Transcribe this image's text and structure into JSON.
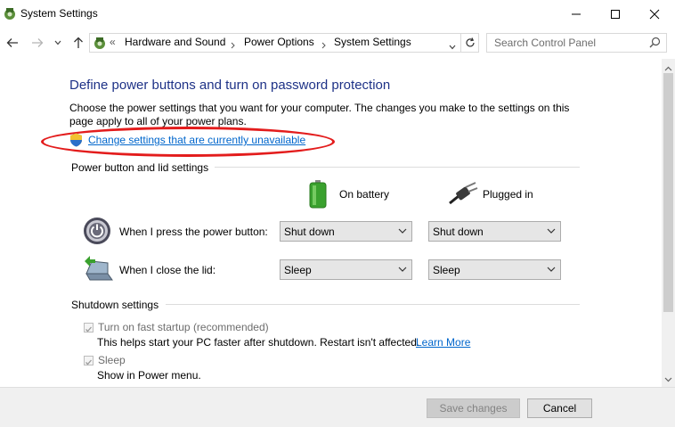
{
  "window": {
    "title": "System Settings",
    "minimize": "—",
    "maximize": "☐",
    "close": "✕"
  },
  "address": {
    "overflow": "«",
    "breadcrumbs": [
      "Hardware and Sound",
      "Power Options",
      "System Settings"
    ],
    "search_placeholder": "Search Control Panel"
  },
  "main": {
    "heading": "Define power buttons and turn on password protection",
    "description": "Choose the power settings that you want for your computer. The changes you make to the settings on this page apply to all of your power plans.",
    "change_link": "Change settings that are currently unavailable",
    "power_section_title": "Power button and lid settings",
    "col_battery": "On battery",
    "col_plugged": "Plugged in",
    "rows": [
      {
        "label": "When I press the power button:",
        "battery": "Shut down",
        "plugged": "Shut down"
      },
      {
        "label": "When I close the lid:",
        "battery": "Sleep",
        "plugged": "Sleep"
      }
    ],
    "shutdown_section_title": "Shutdown settings",
    "fast_startup_label": "Turn on fast startup (recommended)",
    "fast_startup_checked": true,
    "fast_startup_desc": "This helps start your PC faster after shutdown. Restart isn't affected.",
    "learn_more": "Learn More",
    "sleep_label": "Sleep",
    "sleep_checked": true,
    "sleep_desc": "Show in Power menu."
  },
  "footer": {
    "save_label": "Save changes",
    "cancel_label": "Cancel"
  },
  "colors": {
    "heading": "#1e3287",
    "link": "#0066cc",
    "highlight": "#e31c1c"
  }
}
